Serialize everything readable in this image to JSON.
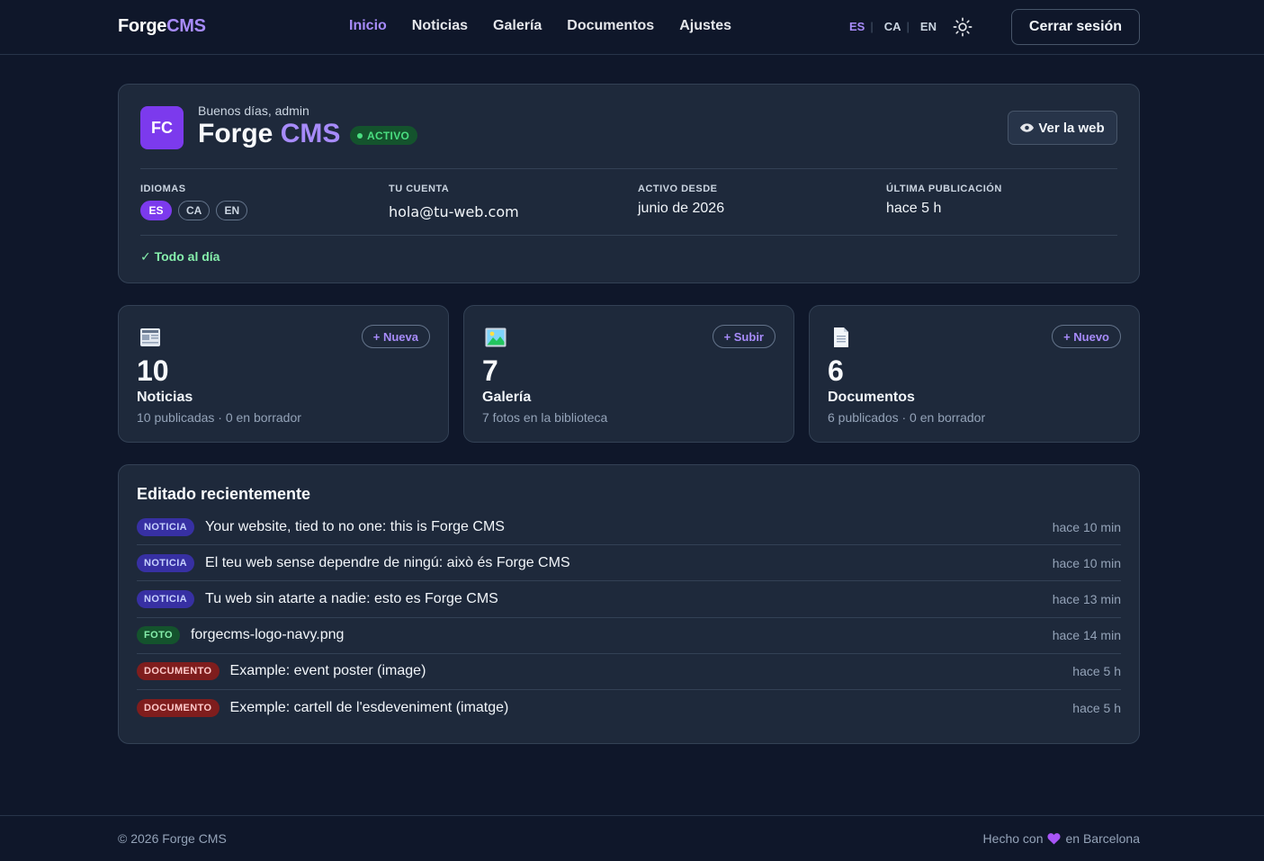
{
  "brand": {
    "part1": "Forge",
    "part2": "CMS"
  },
  "nav": [
    {
      "label": "Inicio",
      "active": true
    },
    {
      "label": "Noticias"
    },
    {
      "label": "Galería"
    },
    {
      "label": "Documentos"
    },
    {
      "label": "Ajustes"
    }
  ],
  "langs": [
    "ES",
    "CA",
    "EN"
  ],
  "logout_label": "Cerrar sesión",
  "hero": {
    "avatar": "FC",
    "greeting": "Buenos días, admin",
    "title_part1": "Forge",
    "title_part2": "CMS",
    "status": "ACTIVO",
    "view_site": "Ver la web",
    "languages_label": "IDIOMAS",
    "languages": [
      "ES",
      "CA",
      "EN"
    ],
    "account_label": "TU CUENTA",
    "account_value": "hola@tu-web.com",
    "active_since_label": "ACTIVO DESDE",
    "active_since_value": "junio de 2026",
    "last_pub_label": "ÚLTIMA PUBLICACIÓN",
    "last_pub_value": "hace 5 h",
    "uptodate": "✓ Todo al día"
  },
  "stats": [
    {
      "number": "10",
      "name": "Noticias",
      "sub": "10 publicadas · 0 en borrador",
      "action": "+ Nueva"
    },
    {
      "number": "7",
      "name": "Galería",
      "sub": "7 fotos en la biblioteca",
      "action": "+ Subir"
    },
    {
      "number": "6",
      "name": "Documentos",
      "sub": "6 publicados · 0 en borrador",
      "action": "+ Nuevo"
    }
  ],
  "recent": {
    "title": "Editado recientemente",
    "items": [
      {
        "tag": "NOTICIA",
        "type": "news",
        "title": "Your website, tied to no one: this is Forge CMS",
        "time": "hace 10 min"
      },
      {
        "tag": "NOTICIA",
        "type": "news",
        "title": "El teu web sense dependre de ningú: això és Forge CMS",
        "time": "hace 10 min"
      },
      {
        "tag": "NOTICIA",
        "type": "news",
        "title": "Tu web sin atarte a nadie: esto es Forge CMS",
        "time": "hace 13 min"
      },
      {
        "tag": "FOTO",
        "type": "photo",
        "title": "forgecms-logo-navy.png",
        "time": "hace 14 min"
      },
      {
        "tag": "DOCUMENTO",
        "type": "doc",
        "title": "Example: event poster (image)",
        "time": "hace 5 h"
      },
      {
        "tag": "DOCUMENTO",
        "type": "doc",
        "title": "Exemple: cartell de l'esdeveniment (imatge)",
        "time": "hace 5 h"
      }
    ]
  },
  "footer": {
    "copy": "© 2026 Forge CMS",
    "made_prefix": "Hecho con",
    "made_suffix": "en Barcelona"
  },
  "colors": {
    "accent": "#a78bfa",
    "accent_strong": "#7c3aed",
    "bg": "#0f172a",
    "card": "#1e293b",
    "success": "#4ade80"
  },
  "icons": {
    "news": "newspaper-icon",
    "gallery": "picture-icon",
    "docs": "document-icon",
    "theme": "sun-icon",
    "view": "eye-icon",
    "heart": "heart-icon"
  }
}
